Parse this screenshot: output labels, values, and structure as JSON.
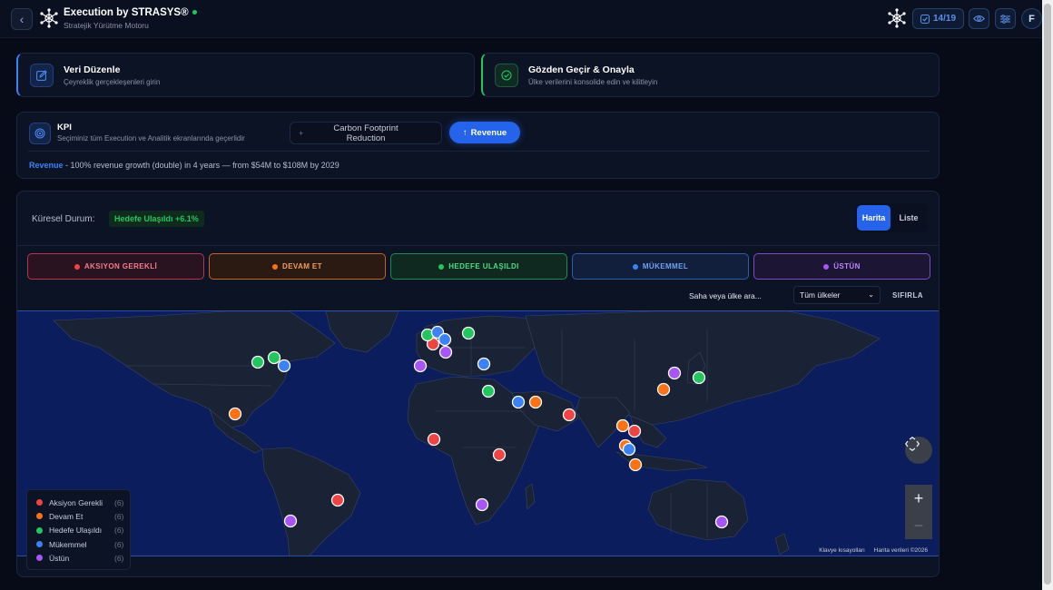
{
  "header": {
    "title": "Execution by STRASYS®",
    "subtitle": "Stratejik Yürütme Motoru",
    "counter": "14/19",
    "avatar_initial": "F",
    "status_color": "#22c55e"
  },
  "steps": [
    {
      "title": "Veri Düzenle",
      "subtitle": "Çeyreklik gerçekleşenleri girin",
      "icon": "edit-icon",
      "accent": "#3b82f6"
    },
    {
      "title": "Gözden Geçir & Onayla",
      "subtitle": "Ülke verilerini konsolide edin ve kilitleyin",
      "icon": "check-circle-icon",
      "accent": "#22c55e"
    }
  ],
  "kpi": {
    "label": "KPI",
    "subtitle": "Seçiminiz tüm Execution ve Analitik ekranlarında geçerlidir",
    "option_1": "Carbon Footprint Reduction",
    "option_active": "Revenue",
    "desc_name": "Revenue",
    "desc_text": " - 100% revenue growth (double) in 4 years — from $54M to $108M by 2029"
  },
  "map_panel": {
    "status_label": "Küresel Durum:",
    "status_badge": "Hedefe Ulaşıldı +6.1%",
    "view_map": "Harita",
    "view_list": "Liste",
    "filters": [
      {
        "label": "AKSIYON GEREKLİ",
        "color": "#ef4444"
      },
      {
        "label": "DEVAM ET",
        "color": "#f97316"
      },
      {
        "label": "HEDEFE ULAŞILDI",
        "color": "#22c55e"
      },
      {
        "label": "MÜKEMMEL",
        "color": "#3b82f6"
      },
      {
        "label": "ÜSTÜN",
        "color": "#a855f7"
      }
    ],
    "search_placeholder": "Saha veya ülke ara...",
    "country_select": "Tüm ülkeler",
    "reset": "SIFIRLA",
    "footer_shortcuts": "Klavye kısayolları",
    "footer_data": "Harita verileri ©2026",
    "legend": [
      {
        "name": "Aksiyon Gerekli",
        "count": "(6)",
        "color": "#ef4444"
      },
      {
        "name": "Devam Et",
        "count": "(6)",
        "color": "#f97316"
      },
      {
        "name": "Hedefe Ulaşıldı",
        "count": "(6)",
        "color": "#22c55e"
      },
      {
        "name": "Mükemmel",
        "count": "(6)",
        "color": "#3b82f6"
      },
      {
        "name": "Üstün",
        "count": "(6)",
        "color": "#a855f7"
      }
    ]
  }
}
